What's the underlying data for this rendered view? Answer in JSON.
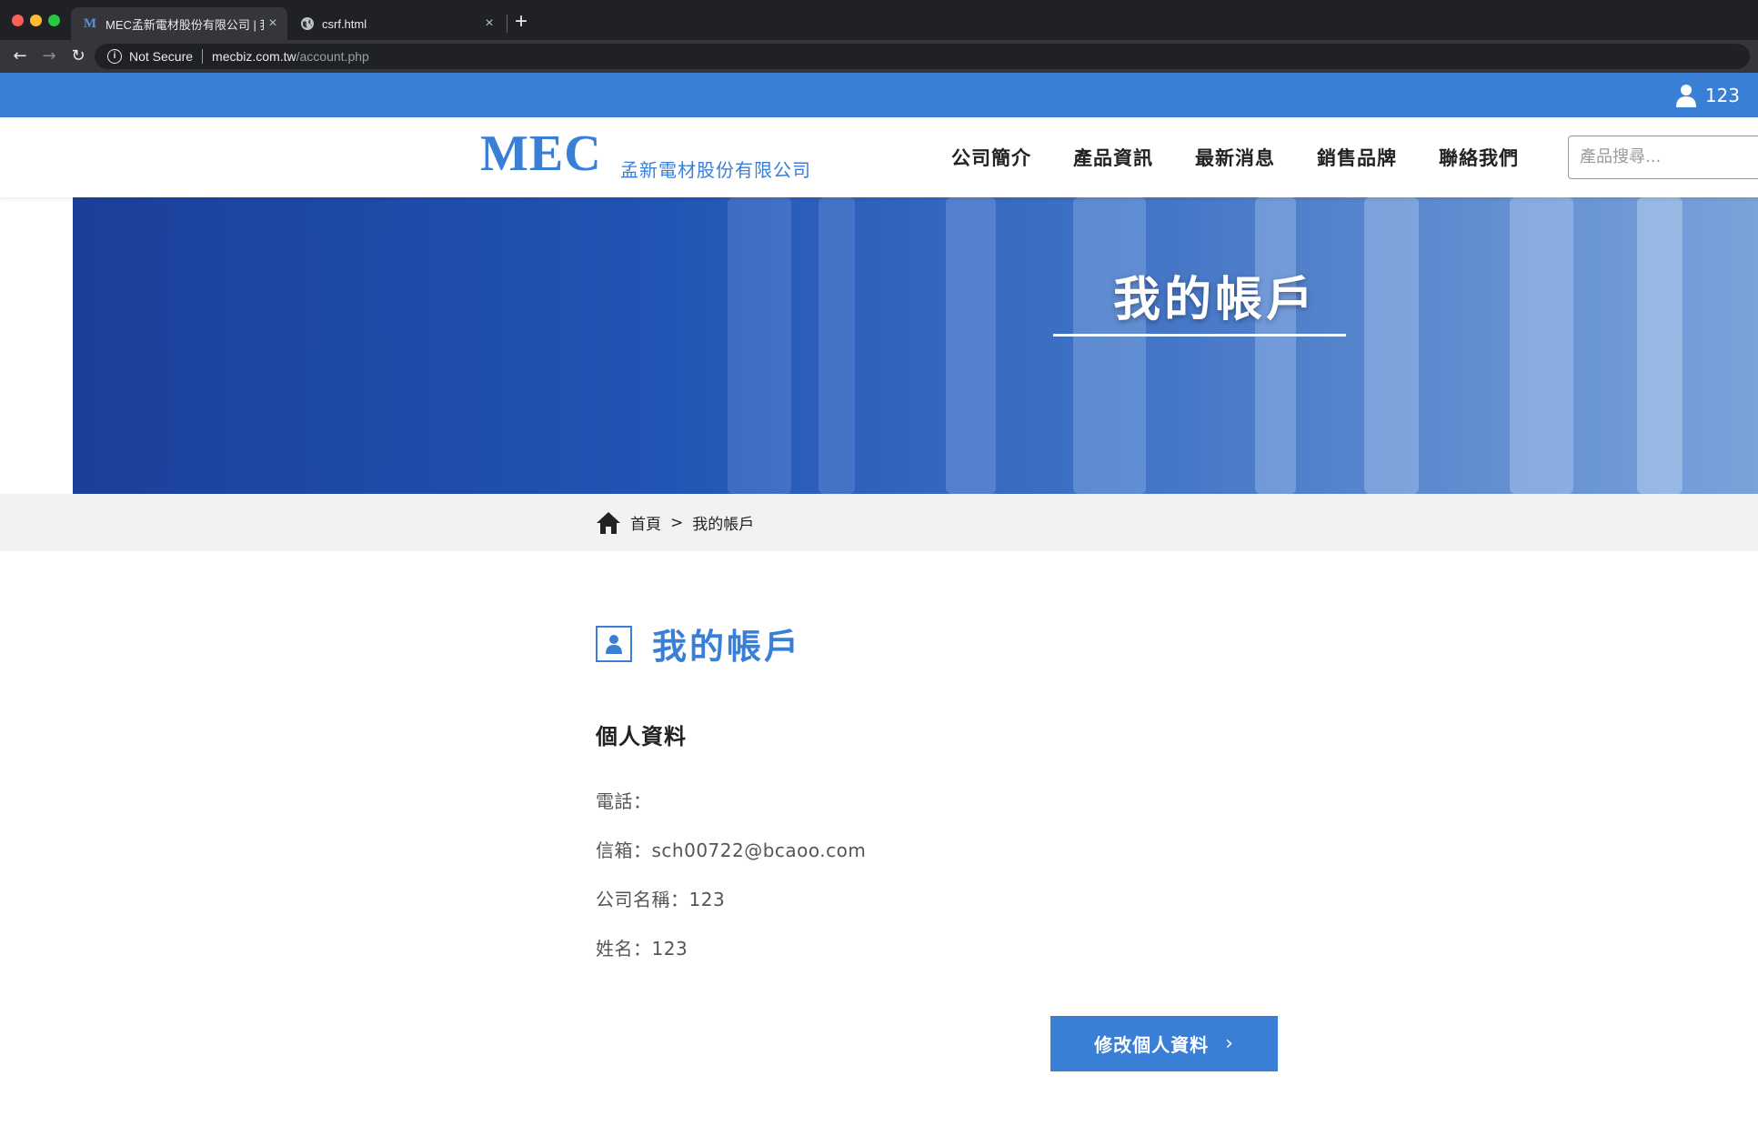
{
  "browser": {
    "tabs": [
      {
        "favicon": "M",
        "title": "MEC孟新電材股份有限公司 | 我的帳戶",
        "active": true
      },
      {
        "favicon": "globe-icon",
        "title": "csrf.html",
        "active": false
      }
    ],
    "security_label": "Not Secure",
    "url_host": "mecbiz.com.tw",
    "url_path": "/account.php"
  },
  "topbar": {
    "username": "123",
    "color": "#3a7fd6"
  },
  "header": {
    "logo_main": "MEC",
    "logo_sub": "孟新電材股份有限公司",
    "nav": [
      "公司簡介",
      "產品資訊",
      "最新消息",
      "銷售品牌",
      "聯絡我們"
    ],
    "search_placeholder": "產品搜尋..."
  },
  "banner": {
    "title": "我的帳戶"
  },
  "breadcrumb": {
    "home": "首頁",
    "separator": ">",
    "current": "我的帳戶"
  },
  "main": {
    "heading": "我的帳戶",
    "section_title": "個人資料",
    "fields": [
      {
        "label": "電話：",
        "value": ""
      },
      {
        "label": "信箱：",
        "value": "sch00722@bcaoo.com"
      },
      {
        "label": "公司名稱：",
        "value": "123"
      },
      {
        "label": "姓名：",
        "value": "123"
      }
    ],
    "edit_button": "修改個人資料"
  }
}
